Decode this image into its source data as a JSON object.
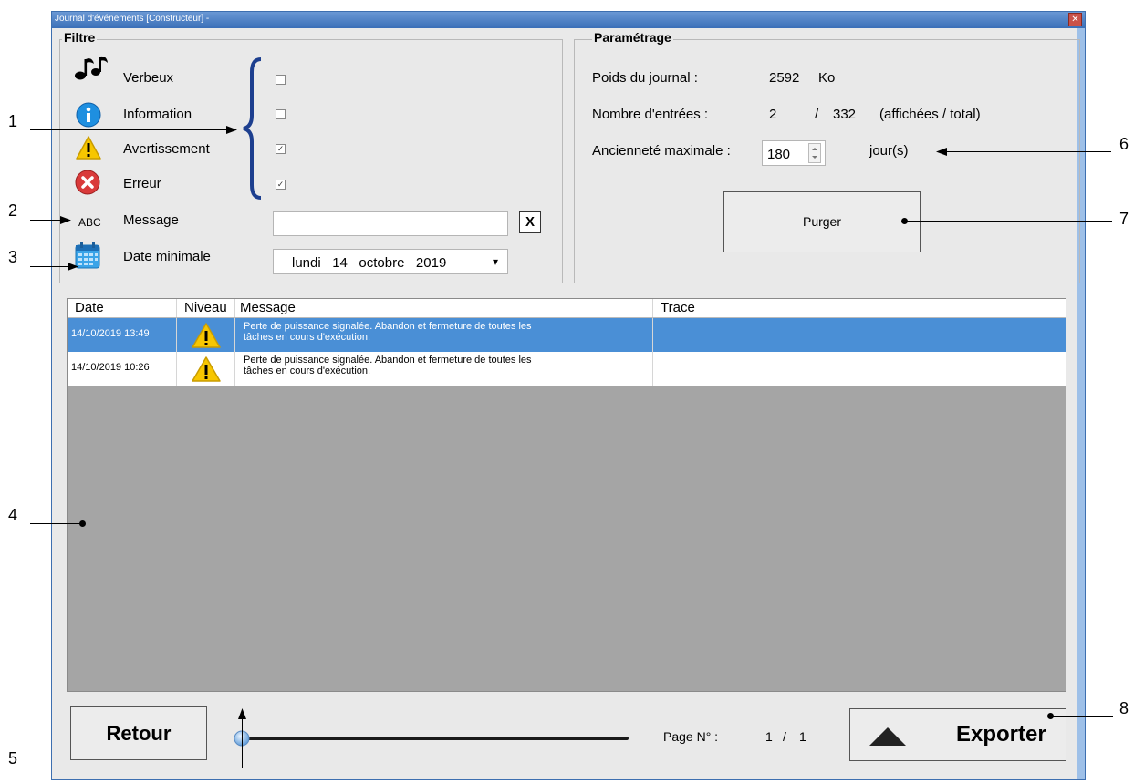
{
  "window": {
    "title": "Journal d'événements [Constructeur] -",
    "close_glyph": "✕"
  },
  "filter": {
    "title": "Filtre",
    "levels": [
      {
        "label": "Verbeux",
        "icon": "music-notes-icon",
        "checked": false
      },
      {
        "label": "Information",
        "icon": "info-icon",
        "checked": false
      },
      {
        "label": "Avertissement",
        "icon": "warning-icon",
        "checked": true
      },
      {
        "label": "Erreur",
        "icon": "error-icon",
        "checked": true
      }
    ],
    "message_icon_text": "ABC",
    "message_label": "Message",
    "message_value": "",
    "clear_label": "X",
    "date_label": "Date minimale",
    "date_value": "lundi   14   octobre   2019",
    "date_dropdown_glyph": "▾"
  },
  "settings": {
    "title": "Paramétrage",
    "weight_label": "Poids du journal :",
    "weight_value": "2592",
    "weight_unit": "Ko",
    "entries_label": "Nombre d'entrées :",
    "entries_shown": "2",
    "entries_sep": "/",
    "entries_total": "332",
    "entries_note": "(affichées / total)",
    "age_label": "Ancienneté maximale :",
    "age_value": "180",
    "age_unit": "jour(s)",
    "purge_label": "Purger"
  },
  "table": {
    "columns": [
      "Date",
      "Niveau",
      "Message",
      "Trace"
    ],
    "rows": [
      {
        "date": "14/10/2019 13:49",
        "level": "warning",
        "message_line1": "Perte de puissance signalée. Abandon et fermeture de toutes les",
        "message_line2": "tâches en cours d'exécution.",
        "trace": "",
        "selected": true
      },
      {
        "date": "14/10/2019 10:26",
        "level": "warning",
        "message_line1": "Perte de puissance signalée. Abandon et fermeture de toutes les",
        "message_line2": "tâches en cours d'exécution.",
        "trace": "",
        "selected": false
      }
    ]
  },
  "footer": {
    "back_label": "Retour",
    "page_label": "Page N° :",
    "page_current": "1",
    "page_sep": "/",
    "page_total": "1",
    "export_label": "Exporter",
    "slider_value": 0
  },
  "callouts": [
    "1",
    "2",
    "3",
    "4",
    "5",
    "6",
    "7",
    "8"
  ],
  "colors": {
    "selection": "#4a8fd6",
    "warning": "#f7c600",
    "info": "#1e8fe0",
    "error": "#d93a3a",
    "window_border": "#3d6fb0"
  }
}
